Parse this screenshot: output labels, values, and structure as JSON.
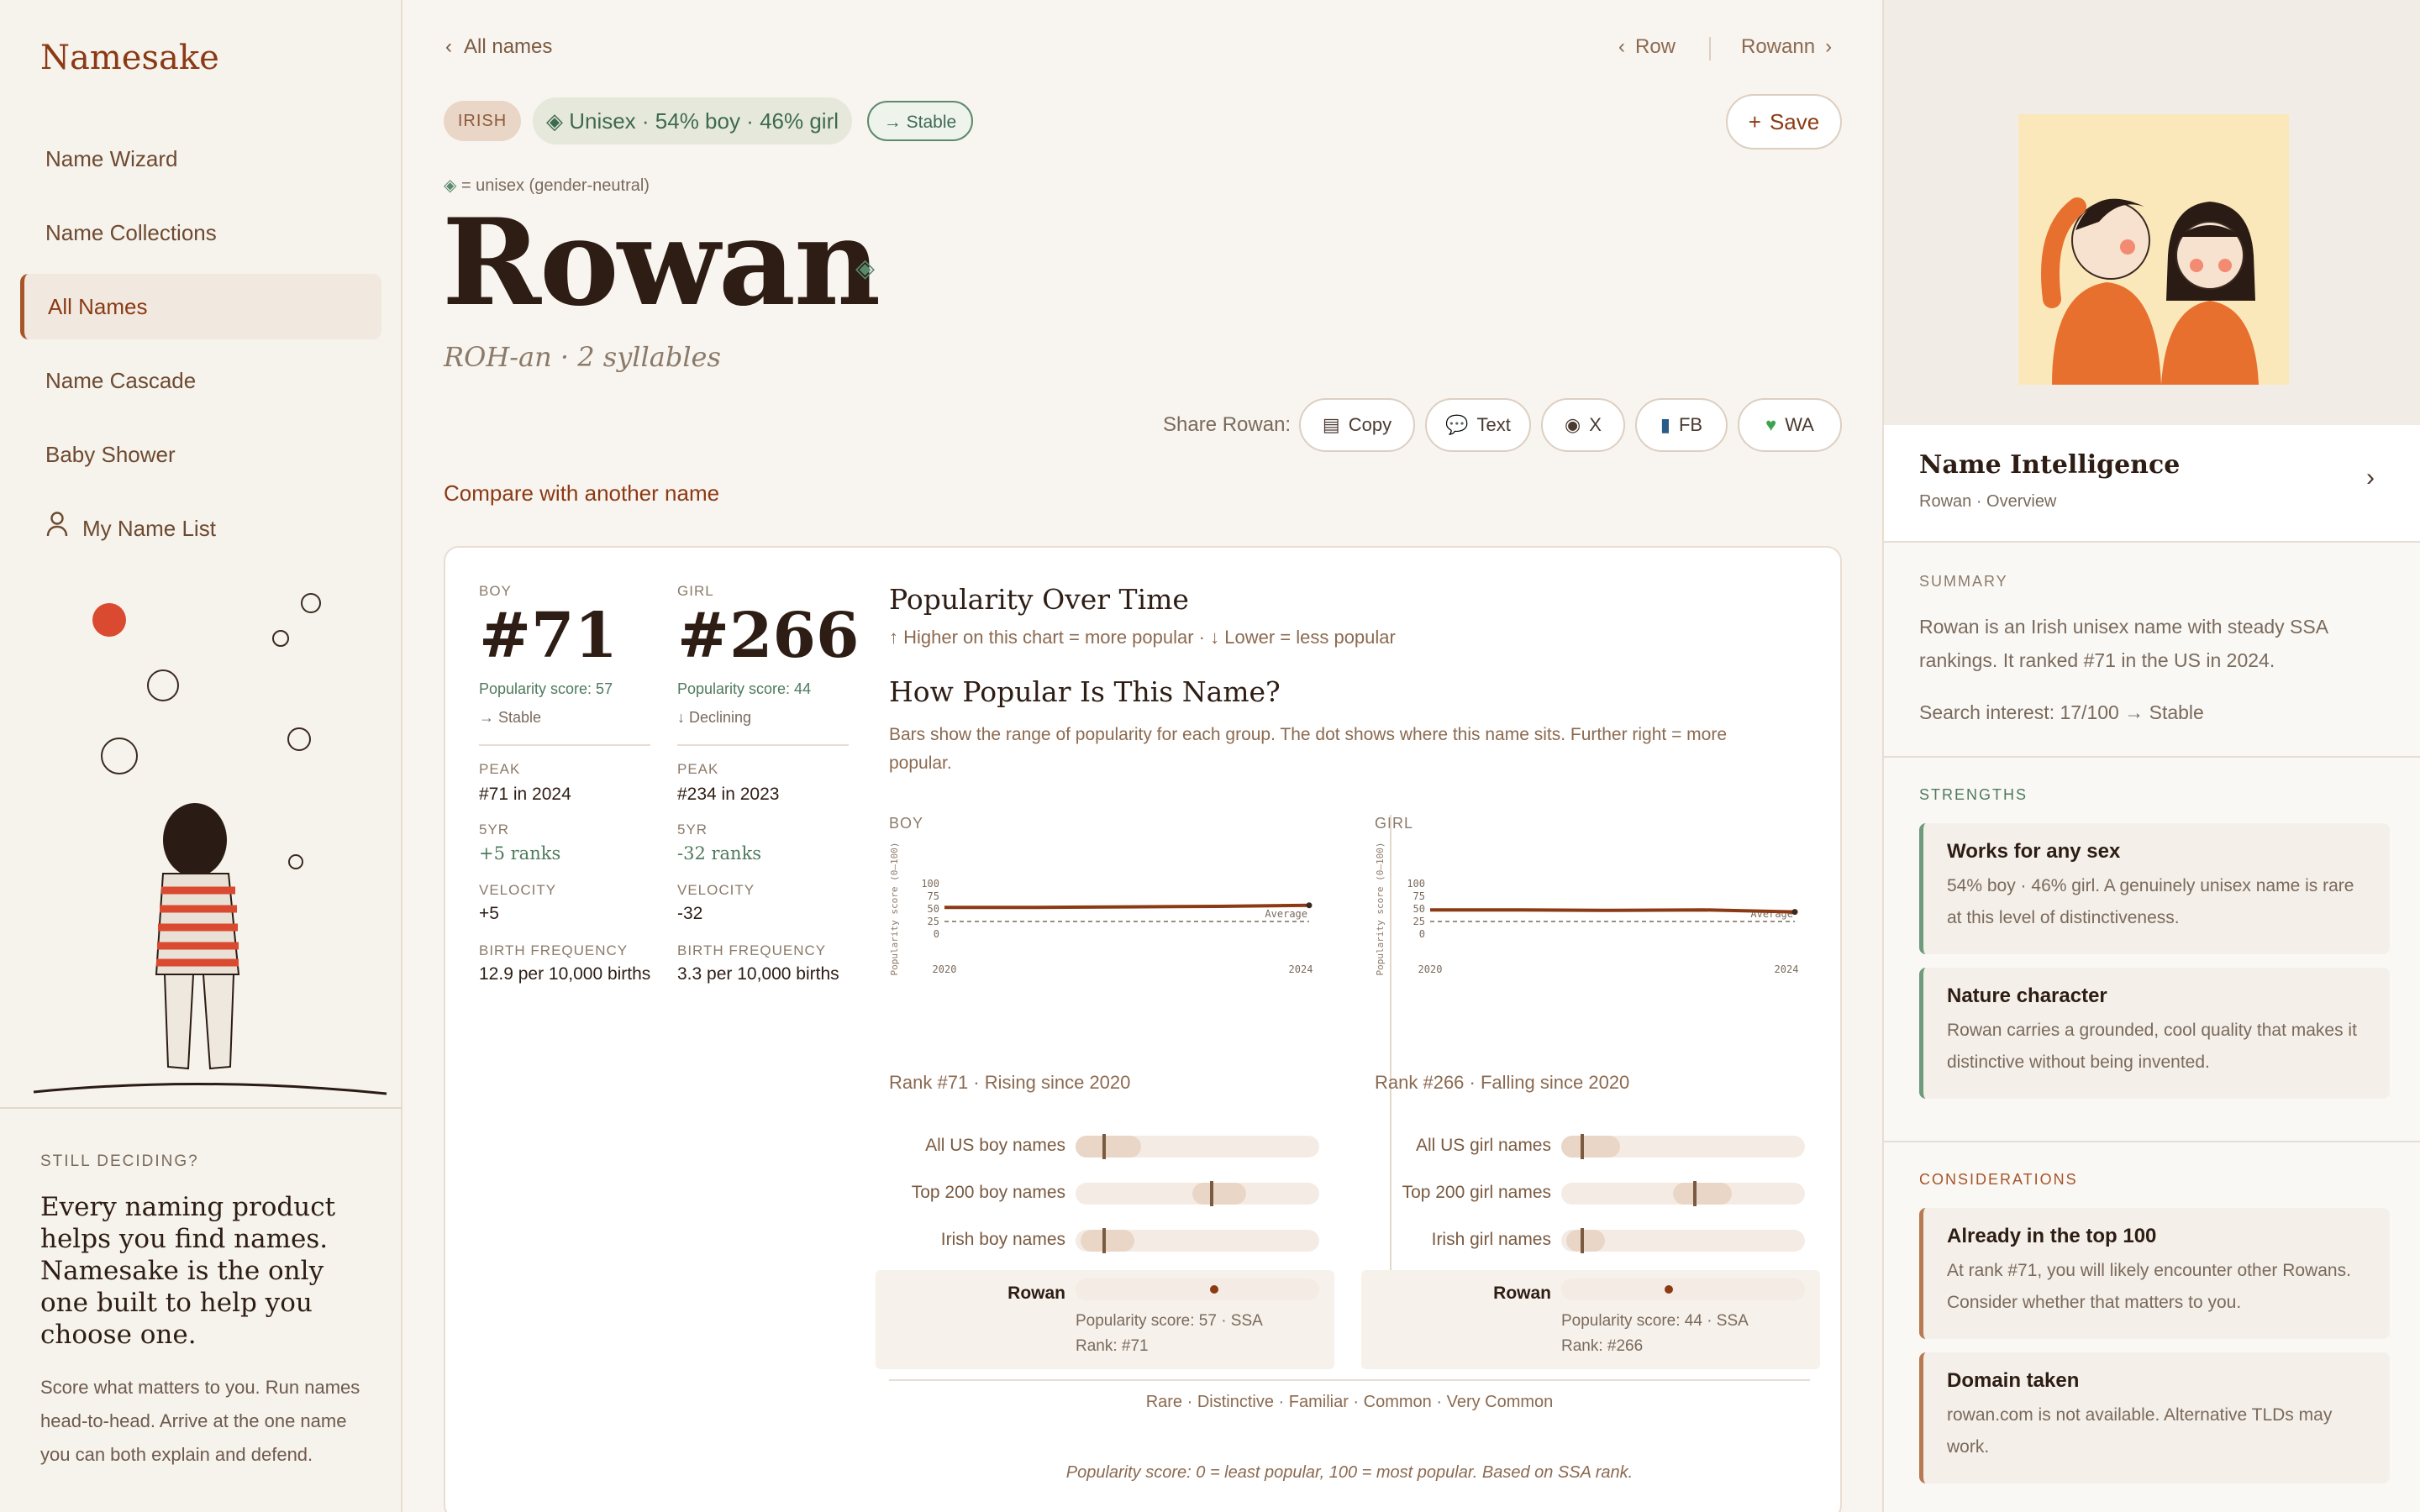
{
  "app": {
    "logo": "Namesake"
  },
  "sidebar": {
    "items": [
      {
        "label": "Name Wizard"
      },
      {
        "label": "Name Collections"
      },
      {
        "label": "All Names"
      },
      {
        "label": "Name Cascade"
      },
      {
        "label": "Baby Shower"
      },
      {
        "label": "My Name List"
      }
    ],
    "promo": {
      "kicker": "STILL DECIDING?",
      "headline": "Every naming product helps you find names. Namesake is the only one built to help you choose one.",
      "body": "Score what matters to you. Run names head-to-head. Arrive at the one name you can both explain and defend."
    }
  },
  "nav": {
    "back": "All names",
    "prev": "Row",
    "next": "Rowann"
  },
  "tags": {
    "origin": "IRISH",
    "gender": "Unisex · 54% boy · 46% girl",
    "trend": "→ Stable",
    "legend": "= unisex (gender-neutral)"
  },
  "save_label": "Save",
  "name": {
    "title": "Rowan",
    "pronunciation": "ROH-an · 2 syllables"
  },
  "share": {
    "label": "Share Rowan:",
    "buttons": [
      {
        "label": "Copy"
      },
      {
        "label": "Text"
      },
      {
        "label": "X"
      },
      {
        "label": "FB"
      },
      {
        "label": "WA"
      }
    ]
  },
  "compare_label": "Compare with another name",
  "stats": {
    "boy": {
      "key": "BOY",
      "rank": "#71",
      "score": "Popularity score: 57",
      "trend": "→ Stable",
      "peak_k": "PEAK",
      "peak": "#71 in 2024",
      "fiveyr_k": "5YR",
      "fiveyr": "+5 ranks",
      "vel_k": "VELOCITY",
      "velocity": "+5",
      "freq_k": "BIRTH FREQUENCY",
      "freq": "12.9 per 10,000 births"
    },
    "girl": {
      "key": "GIRL",
      "rank": "#266",
      "score": "Popularity score: 44",
      "trend": "↓ Declining",
      "peak_k": "PEAK",
      "peak": "#234 in 2023",
      "fiveyr_k": "5YR",
      "fiveyr": "-32 ranks",
      "vel_k": "VELOCITY",
      "velocity": "-32",
      "freq_k": "BIRTH FREQUENCY",
      "freq": "3.3 per 10,000 births"
    }
  },
  "pot": {
    "title": "Popularity Over Time",
    "subtitle": "↑ Higher on this chart = more popular · ↓ Lower = less popular"
  },
  "how": {
    "title": "How Popular Is This Name?",
    "desc": "Bars show the range of popularity for each group. The dot shows where this name sits. Further right = more popular."
  },
  "chart_data": [
    {
      "type": "line",
      "title": "BOY",
      "ylabel": "Popularity score (0–100)",
      "x": [
        2020,
        2021,
        2022,
        2023,
        2024
      ],
      "series": [
        {
          "values": [
            53,
            53,
            54,
            55,
            57
          ]
        }
      ],
      "reference": {
        "label": "Average",
        "value": 25
      },
      "yticks": [
        0,
        25,
        50,
        75,
        100
      ],
      "ylim": [
        0,
        100
      ],
      "xticks": [
        "2020",
        "2024"
      ]
    },
    {
      "type": "line",
      "title": "GIRL",
      "ylabel": "Popularity score (0–100)",
      "x": [
        2020,
        2021,
        2022,
        2023,
        2024
      ],
      "series": [
        {
          "values": [
            48,
            48,
            47,
            48,
            44
          ]
        }
      ],
      "reference": {
        "label": "Average",
        "value": 25
      },
      "yticks": [
        0,
        25,
        50,
        75,
        100
      ],
      "ylim": [
        0,
        100
      ],
      "xticks": [
        "2020",
        "2024"
      ]
    }
  ],
  "ranges": {
    "boy": {
      "summary": "Rank #71 · Rising since 2020",
      "rows": [
        {
          "label": "All US boy names",
          "lo": 0.0,
          "hi": 0.27,
          "mark": 0.11
        },
        {
          "label": "Top 200 boy names",
          "lo": 0.48,
          "hi": 0.7,
          "mark": 0.55
        },
        {
          "label": "Irish boy names",
          "lo": 0.02,
          "hi": 0.24,
          "mark": 0.11
        }
      ],
      "you": {
        "label": "Rowan",
        "dot": 0.57,
        "score": "Popularity score: 57",
        "source": "SSA",
        "rank": "Rank: #71"
      }
    },
    "girl": {
      "summary": "Rank #266 · Falling since 2020",
      "rows": [
        {
          "label": "All US girl names",
          "lo": 0.0,
          "hi": 0.24,
          "mark": 0.08
        },
        {
          "label": "Top 200 girl names",
          "lo": 0.46,
          "hi": 0.7,
          "mark": 0.54
        },
        {
          "label": "Irish girl names",
          "lo": 0.02,
          "hi": 0.18,
          "mark": 0.08
        }
      ],
      "you": {
        "label": "Rowan",
        "dot": 0.44,
        "score": "Popularity score: 44",
        "source": "SSA",
        "rank": "Rank: #266"
      }
    }
  },
  "scale": [
    "Rare",
    "Distinctive",
    "Familiar",
    "Common",
    "Very Common"
  ],
  "footnote": "Popularity score: 0 = least popular, 100 = most popular. Based on SSA rank.",
  "right": {
    "ni_title": "Name Intelligence",
    "ni_sub": "Rowan · Overview",
    "summary_k": "SUMMARY",
    "summary": "Rowan is an Irish unisex name with steady SSA rankings. It ranked #71 in the US in 2024.",
    "interest": "Search interest: 17/100 → Stable",
    "strengths_k": "STRENGTHS",
    "strengths": [
      {
        "title": "Works for any sex",
        "body": "54% boy · 46% girl. A genuinely unisex name is rare at this level of distinctiveness."
      },
      {
        "title": "Nature character",
        "body": "Rowan carries a grounded, cool quality that makes it distinctive without being invented."
      }
    ],
    "considerations_k": "CONSIDERATIONS",
    "considerations": [
      {
        "title": "Already in the top 100",
        "body": "At rank #71, you will likely encounter other Rowans. Consider whether that matters to you."
      },
      {
        "title": "Domain taken",
        "body": "rowan.com is not available. Alternative TLDs may work."
      }
    ]
  },
  "colors": {
    "accent": "#8b3a14",
    "green": "#4e7a5c",
    "bg": "#f8f4ef"
  }
}
